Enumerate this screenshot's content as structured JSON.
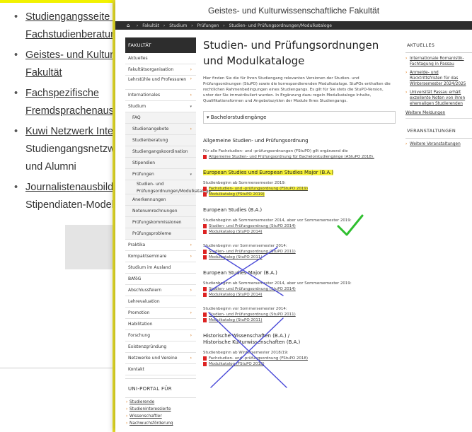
{
  "background_page": {
    "items": [
      {
        "line1": "Studiengangsseite d",
        "line2": "Fachstudienberatun"
      },
      {
        "line1": "Geistes- und Kulturv",
        "line2": "Fakultät"
      },
      {
        "line1": "Fachspezifische",
        "line2": "Fremdsprachenausb"
      },
      {
        "line1": "Kuwi Netzwerk Inter",
        "line2": "Studiengangsnetzw",
        "line3": "und Alumni"
      },
      {
        "line1": "Journalistenausbildu",
        "line2": "Stipendiaten-Modell"
      }
    ]
  },
  "site": {
    "header": "Geistes- und Kulturwissenschaftliche Fakultät",
    "breadcrumb": [
      "Fakultät",
      "Studium",
      "Prüfungen",
      "Studien- und Prüfungsordnungen/Modulkataloge"
    ]
  },
  "nav": {
    "head": "FAKULTÄT",
    "items": [
      {
        "label": "Aktuelles"
      },
      {
        "label": "Fakultätsorganisation",
        "arrow": "›"
      },
      {
        "label": "Lehrstühle und Professuren",
        "arrow": "›"
      },
      {
        "label": "Internationales",
        "arrow": "›"
      },
      {
        "label": "Studium",
        "caret": "▾"
      },
      {
        "label": "FAQ"
      },
      {
        "label": "Studienangebote",
        "arrow": "›"
      },
      {
        "label": "Studienberatung"
      },
      {
        "label": "Studiengangskoordination"
      },
      {
        "label": "Stipendien"
      },
      {
        "label": "Prüfungen",
        "caret": "▾"
      },
      {
        "label": "Studien- und Prüfungsordnungen/Modulkataloge"
      },
      {
        "label": "Anerkennungen"
      },
      {
        "label": "Notenumrechnungen"
      },
      {
        "label": "Prüfungskommissionen"
      },
      {
        "label": "Prüfungsprobleme"
      },
      {
        "label": "Praktika",
        "arrow": "›"
      },
      {
        "label": "Kompaktseminare",
        "arrow": "›"
      },
      {
        "label": "Studium im Ausland"
      },
      {
        "label": "BAföG"
      },
      {
        "label": "Abschlussfeiern",
        "arrow": "›"
      },
      {
        "label": "Lehrevaluation"
      },
      {
        "label": "Promotion",
        "arrow": "›"
      },
      {
        "label": "Habilitation"
      },
      {
        "label": "Forschung",
        "arrow": "›"
      },
      {
        "label": "Existenzgründung"
      },
      {
        "label": "Netzwerke und Vereine",
        "arrow": "›"
      },
      {
        "label": "Kontakt"
      }
    ]
  },
  "portal": {
    "head": "UNI-PORTAL FÜR",
    "links": [
      "Studierende",
      "Studieninteressierte",
      "Wissenschaftler",
      "Nachwuchsförderung"
    ]
  },
  "main": {
    "title_line1": "Studien- und Prüfungsordnungen",
    "title_line2": "und Modulkataloge",
    "intro": "Hier finden Sie die für Ihren Studiengang relevanten Versionen der Studien- und Prüfungsordnungen (StuPO) sowie die korrespondierenden Modulkataloge. StuPOs enthalten die rechtlichen Rahmenbedingungen eines Studiengangs. Es gilt für Sie stets die StuPO-Version, unter der Sie immatrikuliert wurden. In Ergänzung dazu regeln Modulkataloge Inhalte, Qualifikationsformen und Angebotszyklen der Module Ihres Studiengangs.",
    "accordion": "Bachelorstudiengänge",
    "general_title": "Allgemeine Studien- und Prüfungsordnung",
    "general_text": "Für alle Fachstudien- und -prüfungsordnungen (FStuPO) gilt ergänzend die",
    "general_link": "Allgemeine Studien- und Prüfungsordnung für Bachelorstudiengänge (AStuPO 2018).",
    "esm_title": "European Studies und European Studies Major (B.A.)",
    "esm_begin": "Studienbeginn ab Sommersemester 2019:",
    "esm_link1": "Fachstudien- und -prüfungsordnung (FStuPO 2019)",
    "esm_link2": "Modulkatalog (FStuPO 2019)",
    "es_title": "European Studies (B.A.)",
    "es_begin1": "Studienbeginn ab Sommersemester 2014, aber vor Sommersemester 2019:",
    "es_link1": "Studien- und Prüfungsordnung (StuPO 2014)",
    "es_link2": "Modulkatalog (StuPO 2014)",
    "es_begin2": "Studienbeginn vor Sommersemester 2014:",
    "es_link3": "Studien- und Prüfungsordnung (StuPO 2011)",
    "es_link4": "Modulkatalog (StuPO 2011)",
    "esmj_title": "European Studies Major (B.A.)",
    "esmj_begin1": "Studienbeginn ab Sommersemester 2014, aber vor Sommersemester 2019:",
    "esmj_link1": "Studien- und Prüfungsordnung (StuPO 2014)",
    "esmj_link2": "Modulkatalog (StuPO 2014)",
    "esmj_begin2": "Studienbeginn vor Sommersemester 2014:",
    "esmj_link3": "Studien- und Prüfungsordnung (StuPO 2011)",
    "esmj_link4": "Modulkatalog (StuPO 2011)",
    "hw_title1": "Historische Wissenschaften (B.A.) /",
    "hw_title2": "Historische Kulturwissenschaften (B.A.)",
    "hw_begin": "Studienbeginn ab Wintersemester 2018/19:",
    "hw_link1": "Fachstudien- und -prüfungsordnung (FStuPO 2018)",
    "hw_link2": "Modulkatalog (FStuPO 2018)"
  },
  "right": {
    "news_head": "AKTUELLES",
    "news": [
      "Internationale Romanistik-Fachtagung in Passau",
      "Anmelde- und Rücktrittsfristen für das Wintersemester 2024/2025",
      "Universität Passau erhält exzellente Noten von ihren ehemaligen Studierenden"
    ],
    "more_news": "Weitere Meldungen",
    "events_head": "VERANSTALTUNGEN",
    "more_events": "Weitere Veranstaltungen"
  },
  "annotations": {
    "highlight_color": "#f7f23a",
    "check_color": "#2fbf2f",
    "cross_color": "#4a4ad8"
  }
}
